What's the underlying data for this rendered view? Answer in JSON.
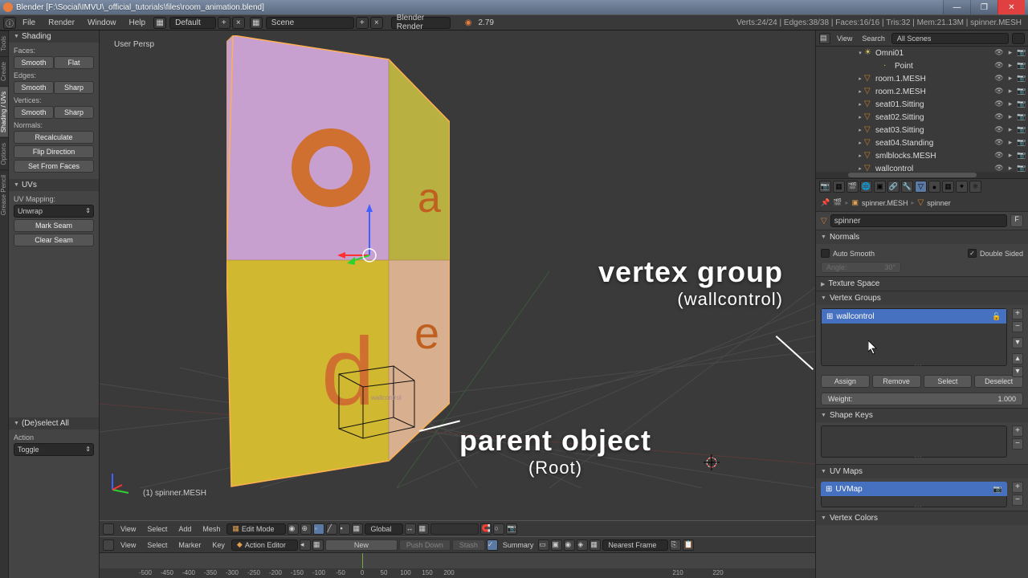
{
  "titlebar": "Blender  [F:\\Social\\IMVU\\_official_tutorials\\files\\room_animation.blend]",
  "menu": {
    "file": "File",
    "render": "Render",
    "window": "Window",
    "help": "Help"
  },
  "layout_drop": "Default",
  "scene_drop": "Scene",
  "engine_drop": "Blender Render",
  "version": "2.79",
  "stats": "Verts:24/24 | Edges:38/38 | Faces:16/16 | Tris:32 | Mem:21.13M | spinner.MESH",
  "left_tabs": {
    "tools": "Tools",
    "create": "Create",
    "shading_uvs": "Shading / UVs",
    "options": "Options",
    "grease": "Grease Pencil"
  },
  "shading_panel": {
    "title": "Shading",
    "faces": "Faces:",
    "smooth": "Smooth",
    "flat": "Flat",
    "edges": "Edges:",
    "sharp": "Sharp",
    "vertices": "Vertices:",
    "normals": "Normals:",
    "recalc": "Recalculate",
    "flip": "Flip Direction",
    "setfrom": "Set From Faces"
  },
  "uvs_panel": {
    "title": "UVs",
    "mapping": "UV Mapping:",
    "unwrap": "Unwrap",
    "mark": "Mark Seam",
    "clear": "Clear Seam"
  },
  "deselect_panel": {
    "title": "(De)select All",
    "action": "Action",
    "toggle": "Toggle"
  },
  "viewport": {
    "persp": "User Persp",
    "objname": "(1) spinner.MESH",
    "wallctrl_label": "wallcontrol"
  },
  "annotations": {
    "vg": "vertex group",
    "vg_sub": "(wallcontrol)",
    "po": "parent object",
    "po_sub": "(Root)"
  },
  "vp_bar": {
    "view": "View",
    "select": "Select",
    "add": "Add",
    "mesh": "Mesh",
    "mode": "Edit Mode",
    "orient": "Global"
  },
  "action_bar": {
    "view": "View",
    "select": "Select",
    "marker": "Marker",
    "key": "Key",
    "editor": "Action Editor",
    "new": "New",
    "push": "Push Down",
    "stash": "Stash",
    "summary": "Summary",
    "nearest": "Nearest Frame"
  },
  "timeline": {
    "current": "1",
    "ticks": [
      "-500",
      "-450",
      "-400",
      "-350",
      "-300",
      "-250",
      "-200",
      "-150",
      "-100",
      "-50",
      "0",
      "50",
      "100",
      "150",
      "200",
      "210",
      "220"
    ]
  },
  "outliner": {
    "view": "View",
    "search": "Search",
    "scenes": "All Scenes",
    "items": [
      {
        "name": "Omni01",
        "indent": 46,
        "exp": "▾",
        "icon": "light"
      },
      {
        "name": "Point",
        "indent": 70,
        "exp": "",
        "icon": "point"
      },
      {
        "name": "room.1.MESH",
        "indent": 46,
        "exp": "▸",
        "icon": "mesh"
      },
      {
        "name": "room.2.MESH",
        "indent": 46,
        "exp": "▸",
        "icon": "mesh"
      },
      {
        "name": "seat01.Sitting",
        "indent": 46,
        "exp": "▸",
        "icon": "mesh"
      },
      {
        "name": "seat02.Sitting",
        "indent": 46,
        "exp": "▸",
        "icon": "mesh"
      },
      {
        "name": "seat03.Sitting",
        "indent": 46,
        "exp": "▸",
        "icon": "mesh"
      },
      {
        "name": "seat04.Standing",
        "indent": 46,
        "exp": "▸",
        "icon": "mesh"
      },
      {
        "name": "smlblocks.MESH",
        "indent": 46,
        "exp": "▸",
        "icon": "mesh"
      },
      {
        "name": "wallcontrol",
        "indent": 46,
        "exp": "▸",
        "icon": "mesh"
      }
    ]
  },
  "breadcrumb": {
    "obj": "spinner.MESH",
    "data": "spinner"
  },
  "props": {
    "name_input": "spinner",
    "fbtn": "F",
    "normals": "Normals",
    "auto_smooth": "Auto Smooth",
    "double_sided": "Double Sided",
    "angle_label": "Angle:",
    "angle_value": "30°",
    "texture_space": "Texture Space",
    "vertex_groups": "Vertex Groups",
    "vg_item": "wallcontrol",
    "assign": "Assign",
    "remove": "Remove",
    "select": "Select",
    "deselect": "Deselect",
    "weight_label": "Weight:",
    "weight_value": "1.000",
    "shape_keys": "Shape Keys",
    "uv_maps": "UV Maps",
    "uvmap_item": "UVMap",
    "vertex_colors": "Vertex Colors"
  }
}
